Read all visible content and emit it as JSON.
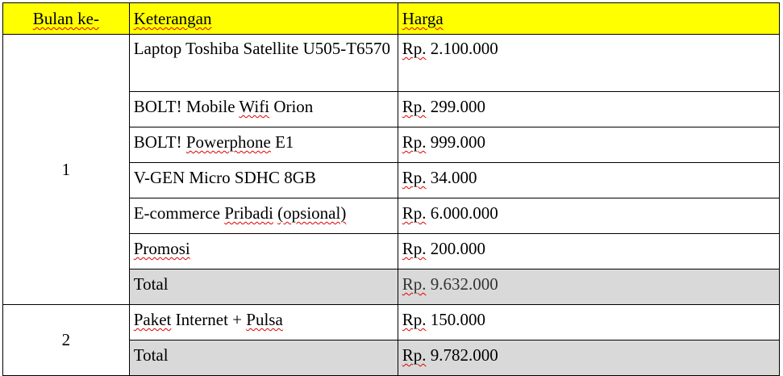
{
  "table": {
    "headers": {
      "month": "Bulan ke-",
      "description": "Keterangan",
      "price": "Harga"
    },
    "groups": [
      {
        "month": "1",
        "rows": [
          {
            "description": "Laptop Toshiba Satellite U505-T6570",
            "price_prefix": "Rp.",
            "price_value": "2.100.000"
          },
          {
            "description_a": "BOLT! Mobile ",
            "description_b": "Wifi",
            "description_c": " Orion",
            "price_prefix": "Rp.",
            "price_value": "299.000"
          },
          {
            "description_a": "BOLT! ",
            "description_b": "Powerphone",
            "description_c": " E1",
            "price_prefix": "Rp.",
            "price_value": "999.000"
          },
          {
            "description": "V-GEN Micro SDHC 8GB",
            "price_prefix": "Rp.",
            "price_value": "34.000"
          },
          {
            "description_a": "E-commerce ",
            "description_b": "Pribadi",
            "description_c": " ",
            "description_d": "(opsional)",
            "price_prefix": "Rp.",
            "price_value": "6.000.000"
          },
          {
            "description": "Promosi",
            "price_prefix": "Rp.",
            "price_value": "200.000"
          },
          {
            "description": "Total",
            "price_prefix": "Rp.",
            "price_value": "9.632.000"
          }
        ]
      },
      {
        "month": "2",
        "rows": [
          {
            "description_a": "Paket",
            "description_b": " Internet + ",
            "description_c": "Pulsa",
            "price_prefix": "Rp.",
            "price_value": "150.000"
          },
          {
            "description": "Total",
            "price_prefix": "Rp.",
            "price_value": "9.782.000"
          }
        ]
      }
    ]
  }
}
